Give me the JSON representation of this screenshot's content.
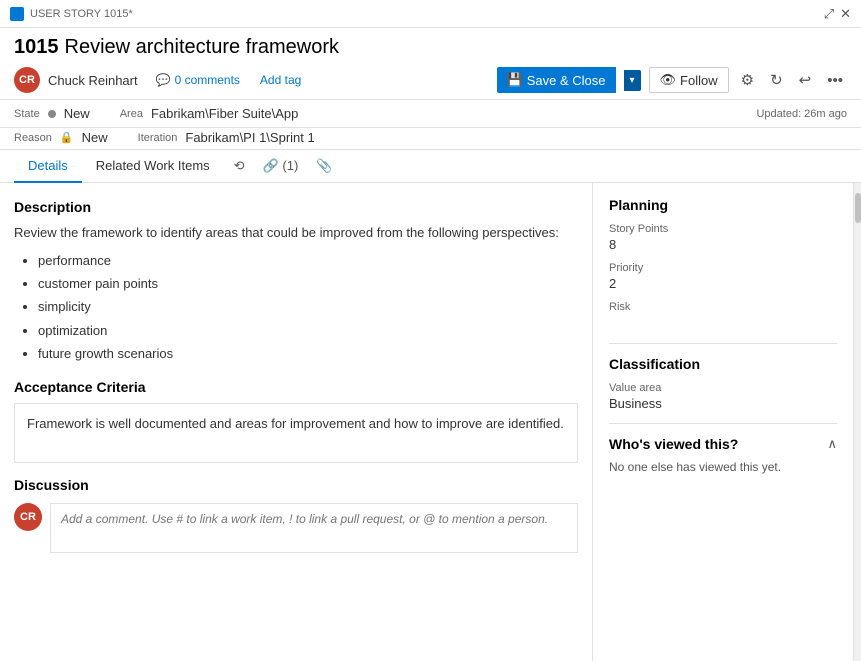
{
  "titlebar": {
    "app_label": "USER STORY 1015*",
    "expand_icon": "⤢",
    "close_icon": "✕"
  },
  "header": {
    "work_item_number": "1015",
    "work_item_title": "Review architecture framework",
    "avatar_initials": "CR",
    "author_name": "Chuck Reinhart",
    "comment_count": "0 comments",
    "add_tag_label": "Add tag",
    "save_close_label": "Save & Close",
    "follow_label": "Follow",
    "save_icon": "💾"
  },
  "metadata": {
    "state_label": "State",
    "state_value": "New",
    "reason_label": "Reason",
    "reason_value": "New",
    "area_label": "Area",
    "area_value": "Fabrikam\\Fiber Suite\\App",
    "iteration_label": "Iteration",
    "iteration_value": "Fabrikam\\PI 1\\Sprint 1",
    "updated_text": "Updated: 26m ago"
  },
  "tabs": {
    "details_label": "Details",
    "related_label": "Related Work Items",
    "history_icon": "⟲",
    "link_label": "(1)",
    "attachment_icon": "📎"
  },
  "left_panel": {
    "description_title": "Description",
    "description_intro": "Review the framework to identify areas that could be improved from the following perspectives:",
    "bullets": [
      "performance",
      "customer pain points",
      "simplicity",
      "optimization",
      "future growth scenarios"
    ],
    "acceptance_title": "Acceptance Criteria",
    "acceptance_text": "Framework is well documented and areas for improvement and how to improve are identified.",
    "discussion_title": "Discussion",
    "comment_placeholder": "Add a comment. Use # to link a work item, ! to link a pull request, or @ to mention a person.",
    "comment_avatar_initials": "CR"
  },
  "right_panel": {
    "planning_title": "Planning",
    "story_points_label": "Story Points",
    "story_points_value": "8",
    "priority_label": "Priority",
    "priority_value": "2",
    "risk_label": "Risk",
    "risk_value": "",
    "classification_title": "Classification",
    "value_area_label": "Value area",
    "value_area_value": "Business",
    "whos_viewed_title": "Who's viewed this?",
    "whos_viewed_text": "No one else has viewed this yet.",
    "collapse_icon": "∧"
  }
}
